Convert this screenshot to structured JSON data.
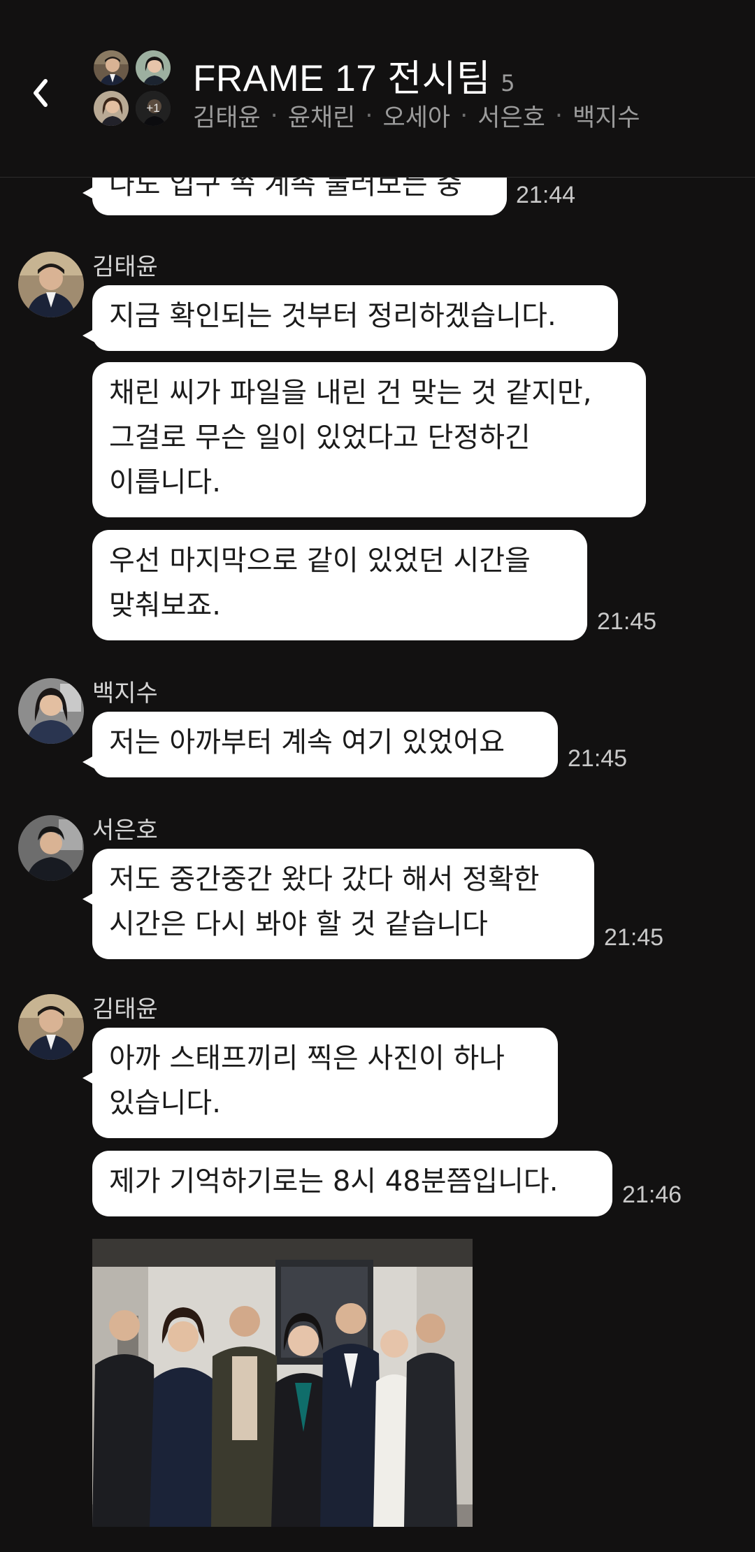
{
  "header": {
    "title": "FRAME 17 전시팀",
    "member_count": "5",
    "members": [
      "김태윤",
      "윤채린",
      "오세아",
      "서은호",
      "백지수"
    ],
    "more_avatars": "+1"
  },
  "messages": {
    "m0": {
      "text": "나도 입구 쪽 계속 둘러보는 중",
      "time": "21:44"
    },
    "g1": {
      "sender": "김태윤",
      "b1": [
        "지금 확인되는 것부터 정리하겠습니다."
      ],
      "b2": [
        "채린 씨가 파일을 내린 건 맞는 것 같지만,",
        "그걸로 무슨 일이 있었다고 단정하긴",
        "이릅니다."
      ],
      "b3": [
        "우선 마지막으로 같이 있었던 시간을",
        "맞춰보죠."
      ],
      "time": "21:45"
    },
    "g2": {
      "sender": "백지수",
      "b1": [
        "저는 아까부터 계속 여기 있었어요"
      ],
      "time": "21:45"
    },
    "g3": {
      "sender": "서은호",
      "b1": [
        "저도 중간중간 왔다 갔다 해서 정확한",
        "시간은 다시 봐야 할 것 같습니다"
      ],
      "time": "21:45"
    },
    "g4": {
      "sender": "김태윤",
      "b1": [
        "아까 스태프끼리 찍은 사진이 하나",
        "있습니다."
      ],
      "b2": [
        "제가 기억하기로는 8시 48분쯤입니다."
      ],
      "time": "21:46"
    }
  },
  "colors": {
    "background": "#121111",
    "bubble": "#ffffff",
    "bubble_text": "#1b1b1b",
    "muted": "#9b9b9b"
  }
}
